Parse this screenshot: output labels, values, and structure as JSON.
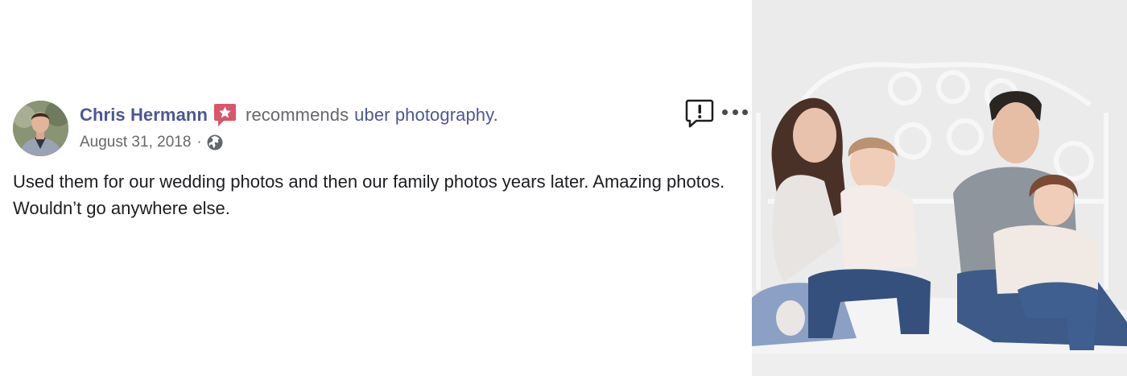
{
  "post": {
    "author": "Chris Hermann",
    "action_text": "recommends",
    "page_name": "uber photography.",
    "date": "August 31, 2018",
    "separator": "·",
    "audience_icon": "globe-icon",
    "badge_icon": "recommendation-star-icon",
    "body": "Used them for our wedding photos and then our family photos years later. Amazing photos. Wouldn’t go anywhere else."
  },
  "actions": {
    "report_icon": "report-flag-icon",
    "more_icon": "more-options-icon"
  },
  "colors": {
    "link": "#4b5896",
    "secondary_text": "#65676b",
    "primary_text": "#1c1e21",
    "badge": "#d9566b"
  },
  "photo": {
    "subject": "family-photo",
    "alt": ""
  }
}
